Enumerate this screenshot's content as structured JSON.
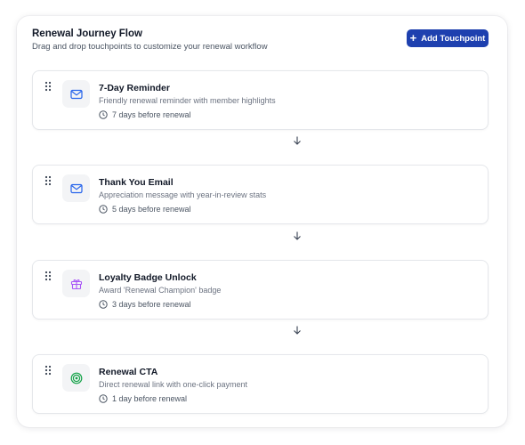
{
  "header": {
    "title": "Renewal Journey Flow",
    "subtitle": "Drag and drop touchpoints to customize your renewal workflow",
    "add_button_label": "Add Touchpoint"
  },
  "touchpoints": [
    {
      "title": "7-Day Reminder",
      "description": "Friendly renewal reminder with member highlights",
      "timing": "7 days before renewal",
      "icon": "mail-icon",
      "icon_color": "#2563eb"
    },
    {
      "title": "Thank You Email",
      "description": "Appreciation message with year-in-review stats",
      "timing": "5 days before renewal",
      "icon": "mail-icon",
      "icon_color": "#2563eb"
    },
    {
      "title": "Loyalty Badge Unlock",
      "description": "Award 'Renewal Champion' badge",
      "timing": "3 days before renewal",
      "icon": "gift-icon",
      "icon_color": "#a855f7"
    },
    {
      "title": "Renewal CTA",
      "description": "Direct renewal link with one-click payment",
      "timing": "1 day before renewal",
      "icon": "target-icon",
      "icon_color": "#16a34a"
    }
  ],
  "colors": {
    "accent": "#1e40af",
    "border": "#e5e7eb"
  }
}
